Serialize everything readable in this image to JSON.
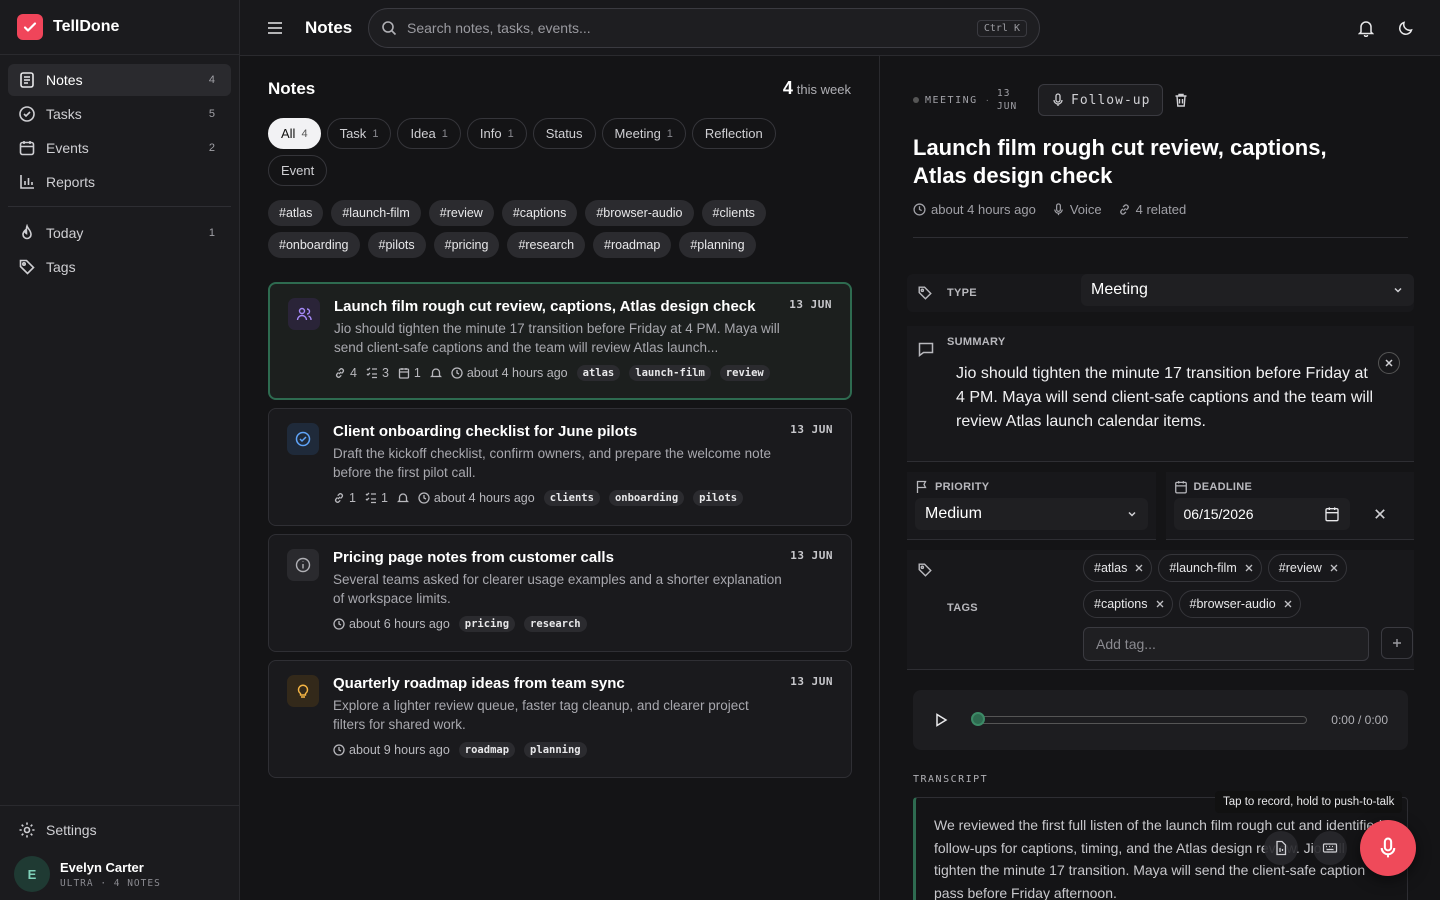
{
  "app": {
    "name": "TellDone"
  },
  "sidebar": {
    "items": [
      {
        "label": "Notes",
        "count": "4",
        "icon": "notes-icon"
      },
      {
        "label": "Tasks",
        "count": "5",
        "icon": "check-circle-icon"
      },
      {
        "label": "Events",
        "count": "2",
        "icon": "calendar-icon"
      },
      {
        "label": "Reports",
        "count": "",
        "icon": "bar-chart-icon"
      }
    ],
    "secondary": [
      {
        "label": "Today",
        "count": "1",
        "icon": "flame-icon"
      },
      {
        "label": "Tags",
        "count": "",
        "icon": "tag-icon"
      }
    ],
    "settings_label": "Settings",
    "user": {
      "initial": "E",
      "name": "Evelyn Carter",
      "meta": "ULTRA · 4 NOTES"
    }
  },
  "topbar": {
    "title": "Notes",
    "search_placeholder": "Search notes, tasks, events...",
    "shortcut": "Ctrl K"
  },
  "notes": {
    "heading": "Notes",
    "week_count": "4",
    "week_label": "this week",
    "filters": [
      {
        "label": "All",
        "count": "4"
      },
      {
        "label": "Task",
        "count": "1"
      },
      {
        "label": "Idea",
        "count": "1"
      },
      {
        "label": "Info",
        "count": "1"
      },
      {
        "label": "Status",
        "count": ""
      },
      {
        "label": "Meeting",
        "count": "1"
      },
      {
        "label": "Reflection",
        "count": ""
      },
      {
        "label": "Event",
        "count": ""
      }
    ],
    "tags": [
      "#atlas",
      "#launch-film",
      "#review",
      "#captions",
      "#browser-audio",
      "#clients",
      "#onboarding",
      "#pilots",
      "#pricing",
      "#research",
      "#roadmap",
      "#planning"
    ],
    "cards": [
      {
        "title": "Launch film rough cut review, captions, Atlas design check",
        "date": "13 JUN",
        "body": "Jio should tighten the minute 17 transition before Friday at 4 PM. Maya will send client-safe captions and the team will review Atlas launch...",
        "links": "4",
        "subtasks": "3",
        "events": "1",
        "time": "about 4 hours ago",
        "tags": [
          "atlas",
          "launch-film",
          "review"
        ]
      },
      {
        "title": "Client onboarding checklist for June pilots",
        "date": "13 JUN",
        "body": "Draft the kickoff checklist, confirm owners, and prepare the welcome note before the first pilot call.",
        "links": "1",
        "subtasks": "1",
        "time": "about 4 hours ago",
        "tags": [
          "clients",
          "onboarding",
          "pilots"
        ]
      },
      {
        "title": "Pricing page notes from customer calls",
        "date": "13 JUN",
        "body": "Several teams asked for clearer usage examples and a shorter explanation of workspace limits.",
        "time": "about 6 hours ago",
        "tags": [
          "pricing",
          "research"
        ]
      },
      {
        "title": "Quarterly roadmap ideas from team sync",
        "date": "13 JUN",
        "body": "Explore a lighter review queue, faster tag cleanup, and clearer project filters for shared work.",
        "time": "about 9 hours ago",
        "tags": [
          "roadmap",
          "planning"
        ]
      }
    ]
  },
  "detail": {
    "kind": "MEETING",
    "date_day": "13",
    "date_month": "JUN",
    "follow_up_label": "Follow-up",
    "title": "Launch film rough cut review, captions, Atlas design check",
    "time_ago": "about 4 hours ago",
    "source": "Voice",
    "related": "4 related",
    "type_label": "TYPE",
    "type_value": "Meeting",
    "summary_label": "SUMMARY",
    "summary": "Jio should tighten the minute 17 transition before Friday at 4 PM. Maya will send client-safe captions and the team will review Atlas launch calendar items.",
    "priority_label": "PRIORITY",
    "priority_value": "Medium",
    "deadline_label": "DEADLINE",
    "deadline_value": "06/15/2026",
    "tags_label": "TAGS",
    "tags": [
      "#atlas",
      "#launch-film",
      "#review",
      "#captions",
      "#browser-audio"
    ],
    "add_tag_placeholder": "Add tag...",
    "player_time": "0:00 / 0:00",
    "player_progress": 0,
    "transcript_label": "TRANSCRIPT",
    "transcript": "We reviewed the first full listen of the launch film rough cut and identified follow-ups for captions, timing, and the Atlas design review. Jio will tighten the minute 17 transition. Maya will send the client-safe caption pass before Friday afternoon."
  },
  "recorder": {
    "tooltip": "Tap to record, hold to push-to-talk"
  },
  "colors": {
    "accent": "#ef4a5a",
    "selected_border": "#2e6b50"
  }
}
